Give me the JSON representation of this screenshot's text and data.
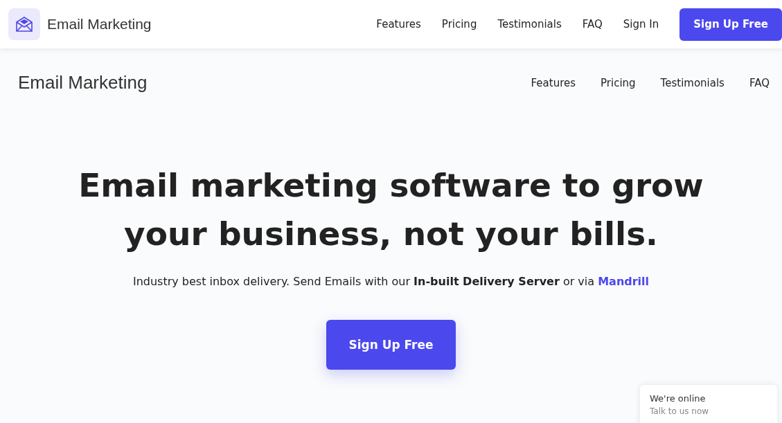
{
  "header": {
    "brand": "Email Marketing",
    "nav": [
      "Features",
      "Pricing",
      "Testimonials",
      "FAQ",
      "Sign In"
    ],
    "cta": "Sign Up Free"
  },
  "page_nav": {
    "brand": "Email Marketing",
    "links": [
      "Features",
      "Pricing",
      "Testimonials",
      "FAQ"
    ]
  },
  "hero": {
    "title": "Email marketing software to grow your business, not your bills.",
    "subtitle": "Industry best inbox delivery. Send Emails with our **In-built Delivery Server** or via ",
    "subtitle_link": "Mandrill",
    "button": "Sign Up Free"
  },
  "chat": {
    "title": "We're online",
    "subtitle": "Talk to us now"
  }
}
